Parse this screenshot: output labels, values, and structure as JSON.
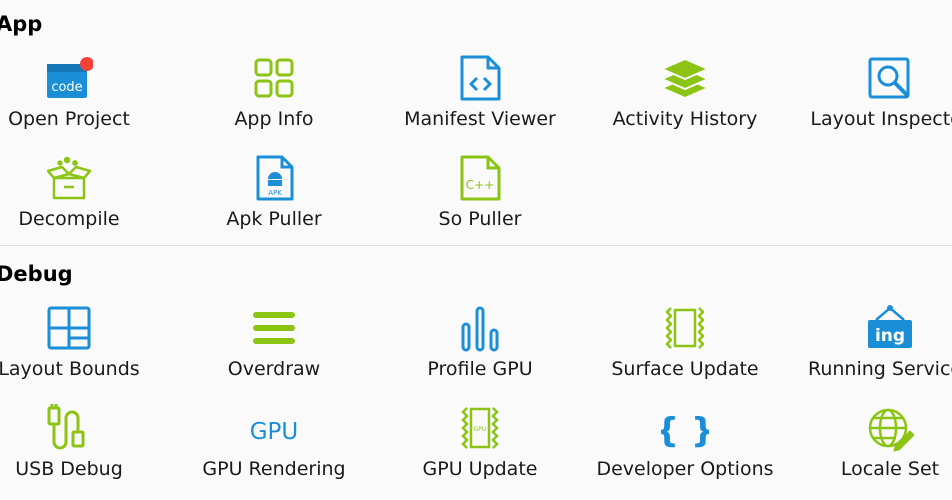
{
  "sections": {
    "app": {
      "title": "App",
      "items": [
        {
          "label": "Open Project",
          "icon": "code-file-icon",
          "icon_text": "code"
        },
        {
          "label": "App Info",
          "icon": "grid-icon"
        },
        {
          "label": "Manifest Viewer",
          "icon": "xml-file-icon"
        },
        {
          "label": "Activity History",
          "icon": "layers-icon"
        },
        {
          "label": "Layout Inspector",
          "icon": "inspect-icon"
        },
        {
          "label": "Decompile",
          "icon": "open-box-icon"
        },
        {
          "label": "Apk Puller",
          "icon": "apk-file-icon",
          "icon_text": "APK"
        },
        {
          "label": "So Puller",
          "icon": "cpp-file-icon",
          "icon_text": "C++"
        }
      ]
    },
    "debug": {
      "title": "Debug",
      "items": [
        {
          "label": "Layout Bounds",
          "icon": "layout-bounds-icon"
        },
        {
          "label": "Overdraw",
          "icon": "overdraw-icon"
        },
        {
          "label": "Profile GPU",
          "icon": "bar-chart-icon"
        },
        {
          "label": "Surface Update",
          "icon": "surface-update-icon"
        },
        {
          "label": "Running Services",
          "icon": "running-services-icon",
          "icon_text": "ing"
        },
        {
          "label": "USB Debug",
          "icon": "usb-cable-icon"
        },
        {
          "label": "GPU Rendering",
          "icon": "gpu-text-icon",
          "icon_text": "GPU"
        },
        {
          "label": "GPU Update",
          "icon": "gpu-chip-icon",
          "icon_text": "GPU"
        },
        {
          "label": "Developer Options",
          "icon": "braces-icon",
          "icon_text": "{ }"
        },
        {
          "label": "Locale Set",
          "icon": "globe-edit-icon"
        }
      ]
    }
  },
  "colors": {
    "blue": "#1a8fd8",
    "green": "#8cc414",
    "badge_red": "#f44336",
    "divider": "#dcdcdc",
    "background": "#fafafa"
  }
}
